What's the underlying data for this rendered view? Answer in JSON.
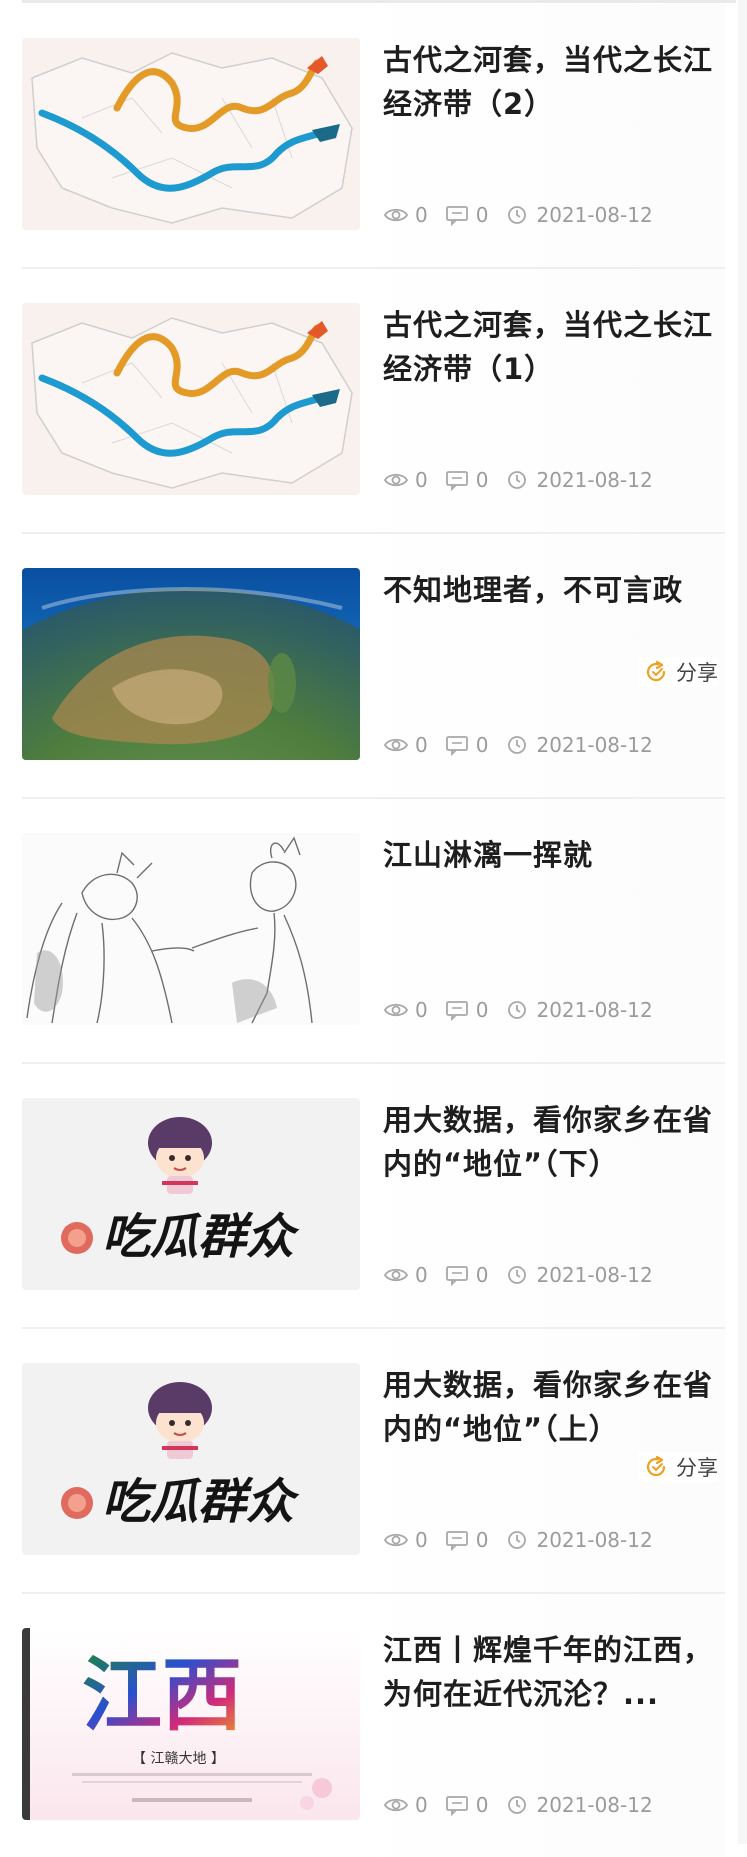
{
  "articles": [
    {
      "title": "古代之河套，当代之长江经济带（2）",
      "views": "0",
      "comments": "0",
      "date": "2021-08-12",
      "thumbnail_icon": "china-rivers-dragon-map-image"
    },
    {
      "title": "古代之河套，当代之长江经济带（1）",
      "views": "0",
      "comments": "0",
      "date": "2021-08-12",
      "thumbnail_icon": "china-rivers-dragon-map-image"
    },
    {
      "title": "不知地理者，不可言政",
      "views": "0",
      "comments": "0",
      "date": "2021-08-12",
      "thumbnail_icon": "earth-globe-image",
      "share_label": "分享"
    },
    {
      "title": "江山淋漓一挥就",
      "views": "0",
      "comments": "0",
      "date": "2021-08-12",
      "thumbnail_icon": "ink-sketch-figures-image"
    },
    {
      "title": "用大数据，看你家乡在省内的“地位”（下）",
      "views": "0",
      "comments": "0",
      "date": "2021-08-12",
      "thumbnail_icon": "cartoon-logo-image",
      "thumbnail_text": "吃瓜群众"
    },
    {
      "title": "用大数据，看你家乡在省内的“地位”（上）",
      "views": "0",
      "comments": "0",
      "date": "2021-08-12",
      "thumbnail_icon": "cartoon-logo-image",
      "thumbnail_text": "吃瓜群众",
      "share_label": "分享"
    },
    {
      "title": "江西丨辉煌千年的江西，为何在近代沉沦？...",
      "views": "0",
      "comments": "0",
      "date": "2021-08-12",
      "thumbnail_icon": "jiangxi-poster-image",
      "thumbnail_text": "江西",
      "thumbnail_subtext": "【 江赣大地 】"
    }
  ],
  "colors": {
    "accent": "#f0a020",
    "meta": "#9b9b9b",
    "title": "#1e1e1e"
  }
}
